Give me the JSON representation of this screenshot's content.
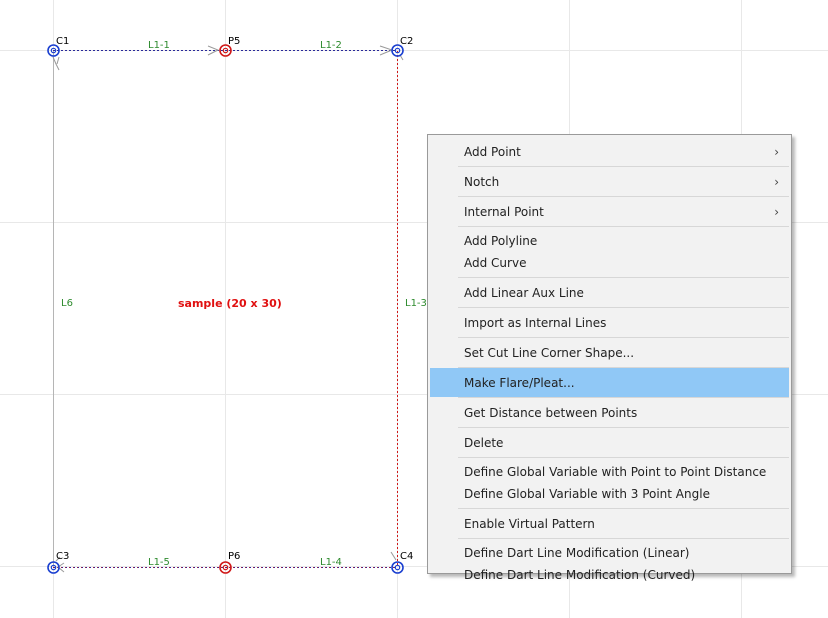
{
  "canvas": {
    "points": {
      "c1": "C1",
      "p5": "P5",
      "c2": "C2",
      "c3": "C3",
      "p6": "P6",
      "c4": "C4"
    },
    "lines": {
      "l1_1": "L1-1",
      "l1_2": "L1-2",
      "l1_3": "L1-3",
      "l1_4": "L1-4",
      "l1_5": "L1-5",
      "l6": "L6"
    },
    "pattern_title": "sample (20 x 30)",
    "colors": {
      "corner_point": "#1a3fd0",
      "mid_point": "#d01818",
      "line_label": "#2e8b2e",
      "title": "#e01010"
    }
  },
  "context_menu": {
    "add_point": "Add Point",
    "notch": "Notch",
    "internal_point": "Internal Point",
    "add_polyline": "Add Polyline",
    "add_curve": "Add Curve",
    "add_linear_aux_line": "Add Linear Aux Line",
    "import_internal_lines": "Import as Internal Lines",
    "set_cut_line_corner_shape": "Set Cut Line Corner Shape...",
    "make_flare_pleat": "Make Flare/Pleat...",
    "get_distance": "Get Distance between Points",
    "delete": "Delete",
    "define_gv_distance": "Define Global Variable with Point to Point Distance",
    "define_gv_angle": "Define Global Variable with 3 Point Angle",
    "enable_virtual_pattern": "Enable Virtual Pattern",
    "dart_linear": "Define Dart Line Modification (Linear)",
    "dart_curved": "Define Dart Line Modification (Curved)",
    "submenu_arrow": "›",
    "highlight_color": "#90c8f6"
  }
}
